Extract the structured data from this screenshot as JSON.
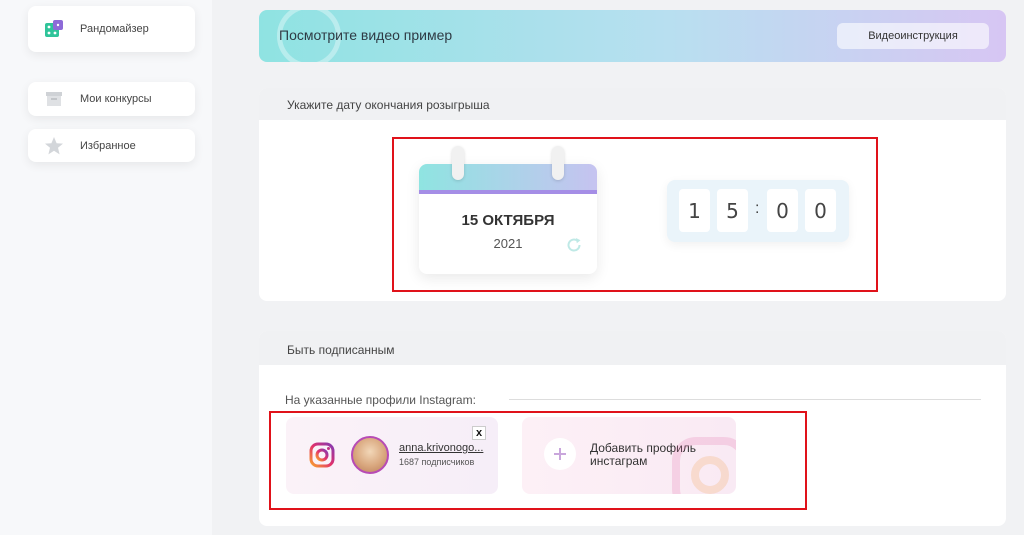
{
  "sidebar": {
    "items": [
      {
        "label": "Рандомайзер",
        "icon": "dice-icon"
      },
      {
        "label": "Мои конкурсы",
        "icon": "box-icon"
      },
      {
        "label": "Избранное",
        "icon": "star-icon"
      }
    ]
  },
  "banner": {
    "title": "Посмотрите видео пример",
    "button_label": "Видеоинструкция"
  },
  "date_section": {
    "heading": "Укажите дату окончания розыгрыша",
    "day_month": "15 ОКТЯБРЯ",
    "year": "2021",
    "time_digits": [
      "1",
      "5",
      "0",
      "0"
    ],
    "time_separator": ":"
  },
  "subscribe_section": {
    "heading": "Быть подписанным",
    "profiles_label": "На указанные профили Instagram:",
    "profile": {
      "username": "anna.krivonogo...",
      "followers": "1687 подписчиков",
      "remove_label": "x"
    },
    "add_profile_label": "Добавить профиль инстаграм"
  },
  "colors": {
    "highlight": "#e0121a",
    "banner_gradient_start": "#8fe3e2",
    "banner_gradient_end": "#d7c6f3",
    "calendar_accent": "#a58ee6"
  }
}
